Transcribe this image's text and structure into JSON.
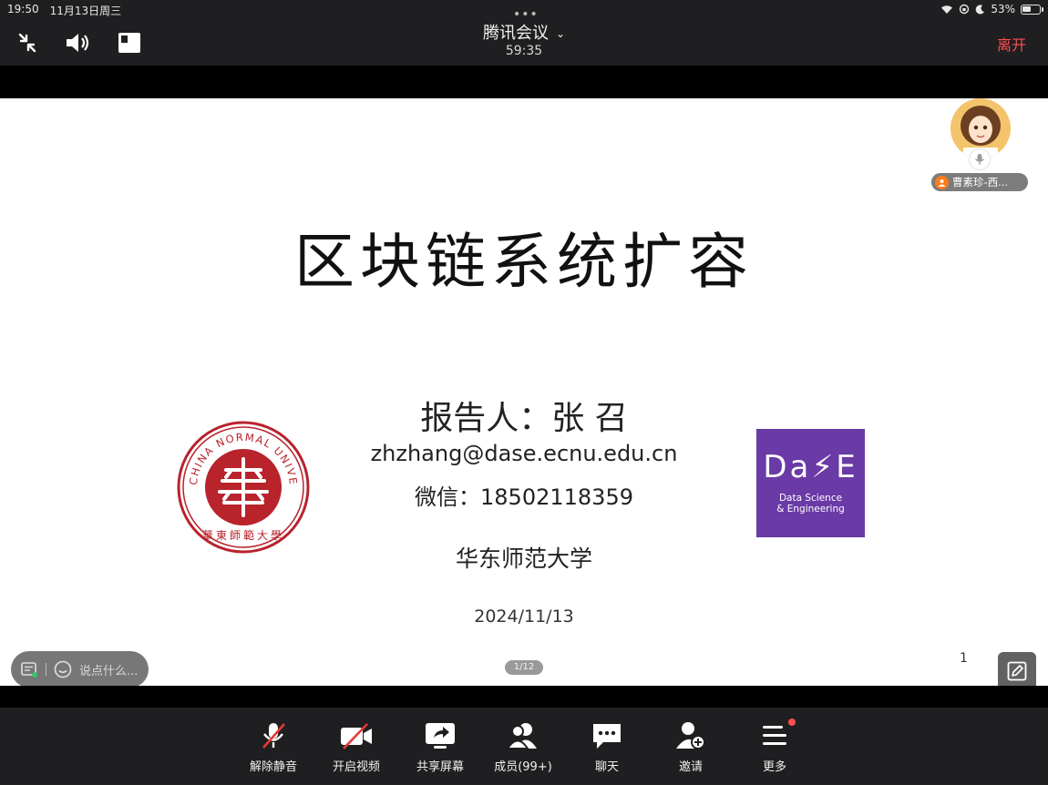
{
  "status_bar": {
    "time": "19:50",
    "date": "11月13日周三",
    "battery": "53%",
    "battery_level": 0.53
  },
  "meeting": {
    "app_title": "腾讯会议",
    "timer": "59:35",
    "leave_label": "离开"
  },
  "slide": {
    "title": "区块链系统扩容",
    "reporter": "报告人：张 召",
    "email": "zhzhang@dase.ecnu.edu.cn",
    "wechat": "微信：18502118359",
    "university": "华东师范大学",
    "date": "2024/11/13",
    "ecnu_logo_text": "EAST CHINA NORMAL UNIVERSITY",
    "ecnu_logo_chinese": "華東師範大學",
    "dase_logo": "Da⚡E",
    "dase_subtitle_1": "Data Science",
    "dase_subtitle_2": "& Engineering",
    "slide_number": "1",
    "page_indicator": "1/12"
  },
  "participant": {
    "name": "曹素珍-西..."
  },
  "chat": {
    "placeholder": "说点什么..."
  },
  "toolbar": {
    "unmute": "解除静音",
    "start_video": "开启视频",
    "share_screen": "共享屏幕",
    "members": "成员(99+)",
    "chat": "聊天",
    "invite": "邀请",
    "more": "更多"
  },
  "colors": {
    "leave": "#ff4d4f",
    "ecnu_red": "#b8232c",
    "dase_purple": "#6a3aa6",
    "toolbar_bg": "#1f1f21"
  }
}
